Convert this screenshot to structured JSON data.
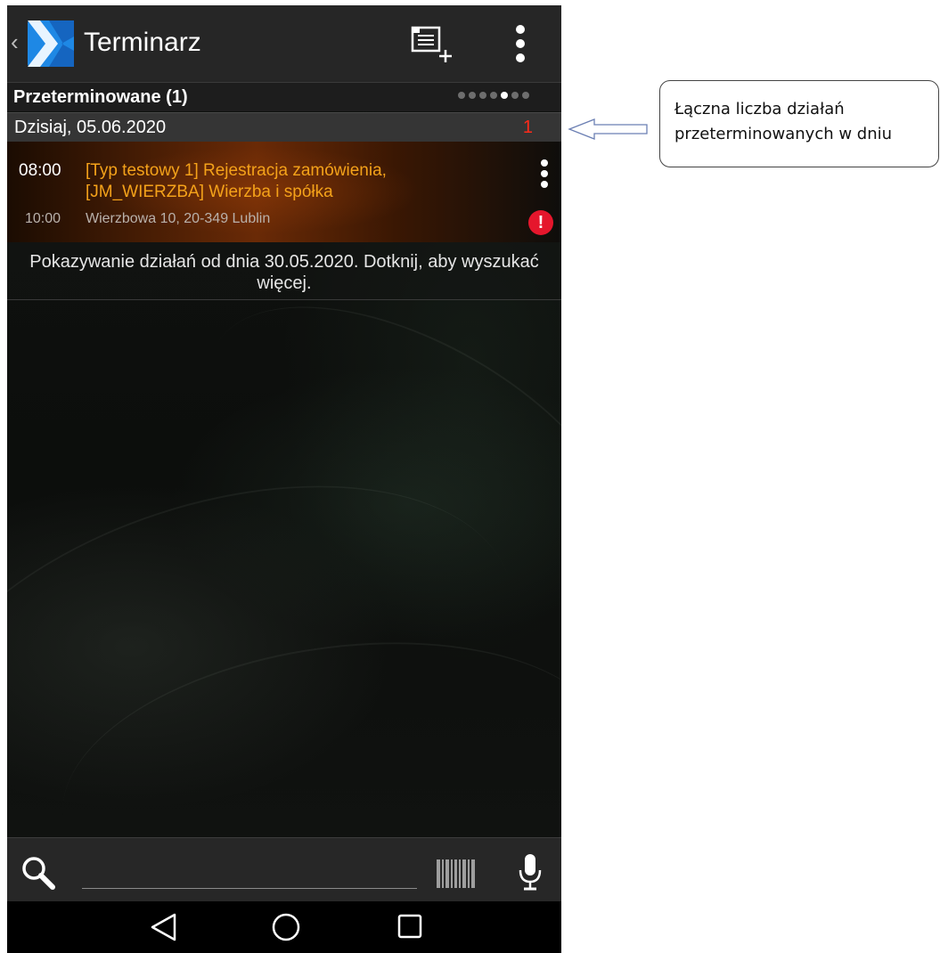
{
  "app": {
    "back_glyph": "‹",
    "title": "Terminarz"
  },
  "section": {
    "title": "Przeterminowane (1)",
    "page_dots": 7,
    "active_page_dot": 5
  },
  "date_group": {
    "label": "Dzisiaj, 05.06.2020",
    "count": "1"
  },
  "activity": {
    "start_time": "08:00",
    "title": "[Typ testowy 1] Rejestracja zamówienia, [JM_WIERZBA] Wierzba i spółka",
    "end_time": "10:00",
    "address": "Wierzbowa 10, 20-349 Lublin",
    "status_icon": "alert-icon",
    "status_glyph": "!"
  },
  "info": {
    "text": "Pokazywanie działań od dnia 30.05.2020. Dotknij, aby wyszukać więcej."
  },
  "search": {
    "value": "",
    "placeholder": ""
  },
  "icons": {
    "search": "search-icon",
    "barcode": "barcode-icon",
    "mic": "mic-icon",
    "new_activity": "new-activity-icon",
    "overflow": "overflow-menu-icon"
  },
  "annotation": {
    "text": "Łączna liczba działań przeterminowanych w dniu"
  },
  "colors": {
    "title_orange": "#f4a21a",
    "count_red": "#ff2a1a",
    "alert_red": "#e5162c",
    "logo_blue": "#1e88e5"
  }
}
